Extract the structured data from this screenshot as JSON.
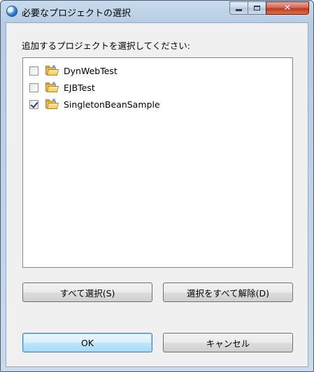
{
  "window": {
    "title": "必要なプロジェクトの選択",
    "controls": {
      "minimize": "minimize",
      "maximize": "maximize",
      "close": "✕"
    }
  },
  "prompt": "追加するプロジェクトを選択してください:",
  "projects": [
    {
      "label": "DynWebTest",
      "checked": false
    },
    {
      "label": "EJBTest",
      "checked": false
    },
    {
      "label": "SingletonBeanSample",
      "checked": true
    }
  ],
  "buttons": {
    "select_all": "すべて選択(S)",
    "deselect_all": "選択をすべて解除(D)",
    "ok": "OK",
    "cancel": "キャンセル"
  },
  "colors": {
    "title_bar": "#b7cce3",
    "close_button": "#c2391e",
    "dialog_background": "#f0f0f0",
    "default_button_border": "#3c7fb1"
  },
  "icons": {
    "app": "globe-icon",
    "project": "folder-icon"
  }
}
